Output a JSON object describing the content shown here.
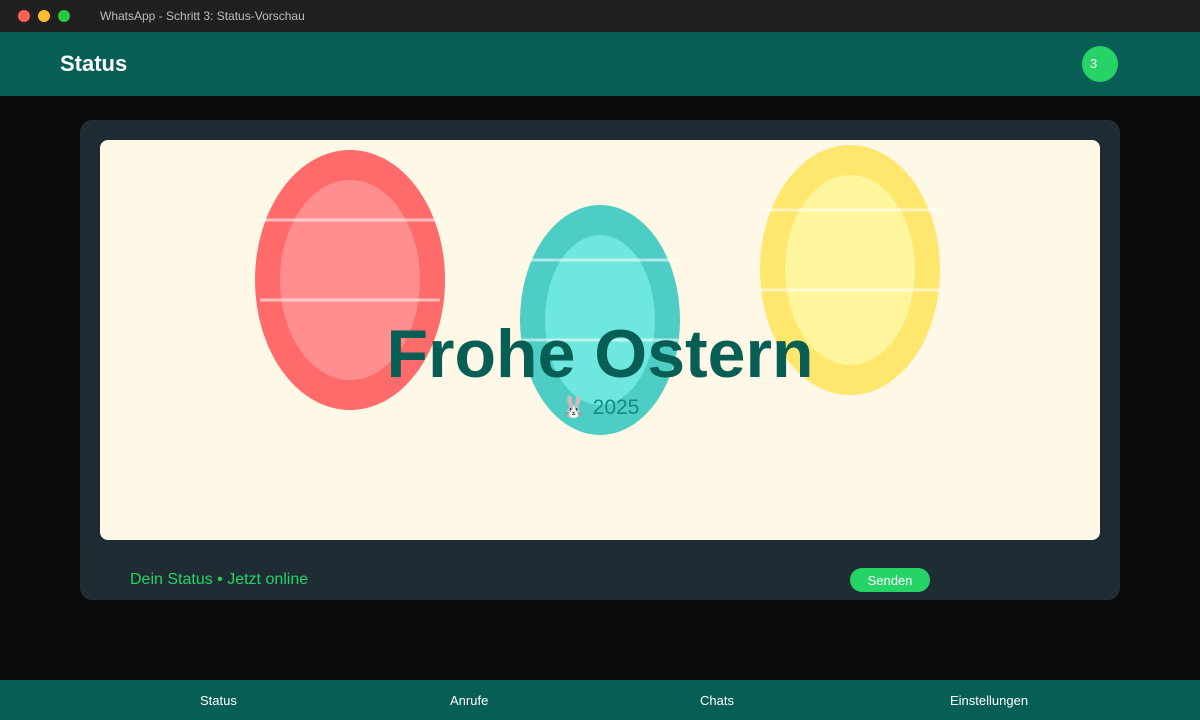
{
  "window": {
    "title": "WhatsApp - Schritt 3: Status-Vorschau"
  },
  "header": {
    "title": "Status",
    "badge_count": "3"
  },
  "preview": {
    "greeting": "Frohe Ostern",
    "subline_icon": "🐰",
    "year": "2025",
    "eggs": [
      {
        "name": "red",
        "outer": "#ff6b6b",
        "inner": "#ff8e8e"
      },
      {
        "name": "teal",
        "outer": "#4ecdc4",
        "inner": "#6ee7de"
      },
      {
        "name": "yellow",
        "outer": "#ffe66d",
        "inner": "#fff59d"
      }
    ],
    "background": "#fff8e7"
  },
  "footer": {
    "status_meta": "Dein Status • Jetzt online",
    "send_label": "Senden"
  },
  "nav": {
    "items": [
      "Status",
      "Anrufe",
      "Chats",
      "Einstellungen"
    ]
  },
  "colors": {
    "brand": "#075e54",
    "accent": "#25d366",
    "panel": "#1f2c34"
  }
}
